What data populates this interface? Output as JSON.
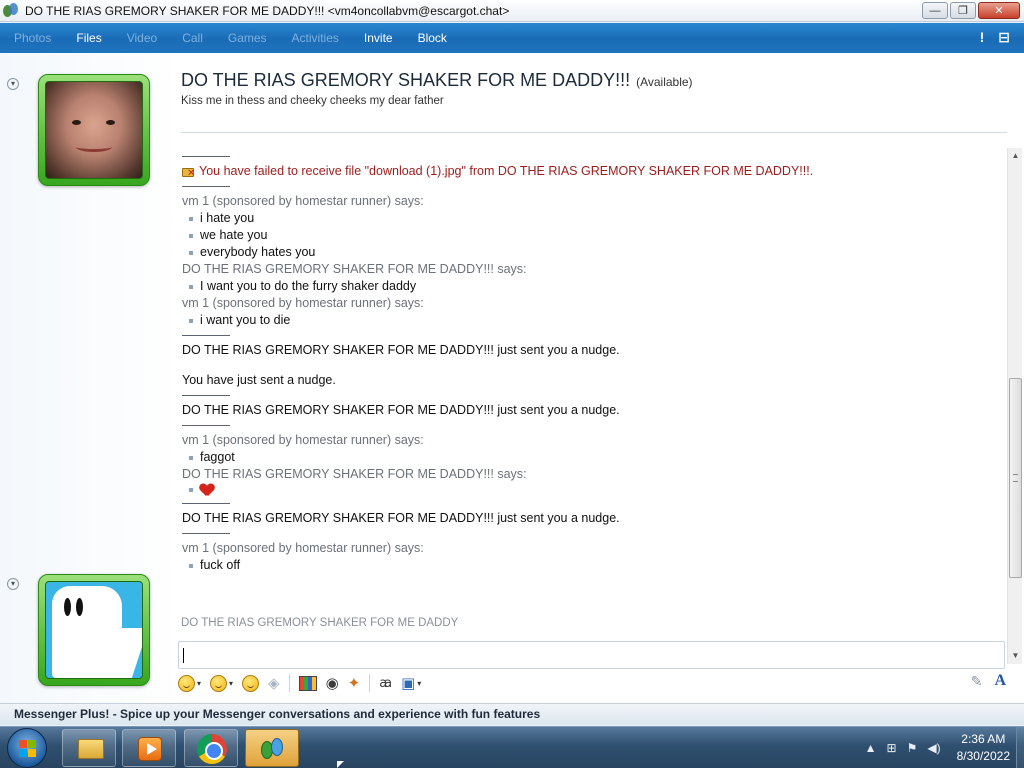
{
  "window": {
    "title": "DO THE RIAS GREMORY SHAKER FOR ME DADDY!!! <vm4oncollabvm@escargot.chat>",
    "minimize_glyph": "—",
    "maximize_glyph": "❐",
    "close_glyph": "✕"
  },
  "menu": {
    "items": [
      {
        "label": "Photos",
        "enabled": false
      },
      {
        "label": "Files",
        "enabled": true
      },
      {
        "label": "Video",
        "enabled": false
      },
      {
        "label": "Call",
        "enabled": false
      },
      {
        "label": "Games",
        "enabled": false
      },
      {
        "label": "Activities",
        "enabled": false
      },
      {
        "label": "Invite",
        "enabled": true
      },
      {
        "label": "Block",
        "enabled": true
      }
    ],
    "right_icons": [
      "!",
      "⊟"
    ]
  },
  "contact": {
    "name": "DO THE RIAS GREMORY SHAKER FOR ME DADDY!!!",
    "status": "(Available)",
    "personal_message": "Kiss me in thess and cheeky cheeks my dear father"
  },
  "conversation": {
    "file_error": "You have failed to receive file \"download (1).jpg\" from DO THE RIAS GREMORY SHAKER FOR ME DADDY!!!.",
    "says_vm1": "vm 1 (sponsored by homestar runner) says:",
    "says_contact": "DO THE RIAS GREMORY SHAKER FOR ME DADDY!!! says:",
    "block1": [
      "i hate you",
      "we hate you",
      "everybody hates you"
    ],
    "block2": [
      "I want you to do the furry shaker daddy"
    ],
    "block3": [
      "i want you to die"
    ],
    "nudge_received": "DO THE RIAS GREMORY SHAKER FOR ME DADDY!!! just sent you a nudge.",
    "nudge_sent": "You have just sent a nudge.",
    "block4": [
      "faggot"
    ],
    "block6": [
      "fuck off"
    ]
  },
  "typing_status": "DO THE RIAS GREMORY SHAKER FOR ME DADDY",
  "toolbar": {
    "font_label": "A"
  },
  "plus_bar": {
    "text": "Messenger Plus! - Spice up your Messenger conversations and experience with fun features"
  },
  "taskbar": {
    "time": "2:36 AM",
    "date": "8/30/2022",
    "tray_arrow": "▲"
  },
  "colors": {
    "menubar": "#1a6bb6",
    "error_text": "#9b1c1c",
    "avatar_frame": "#37a61d"
  }
}
